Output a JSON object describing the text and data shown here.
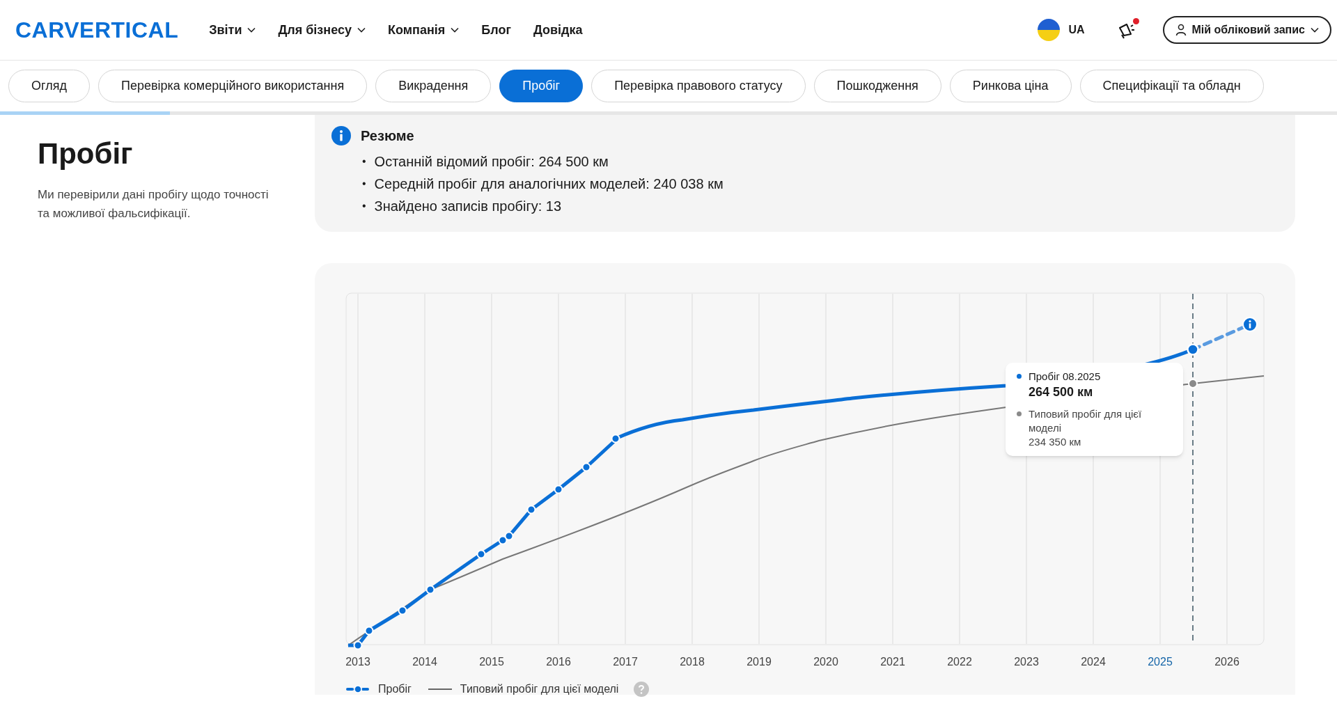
{
  "header": {
    "logo": "CARVERTICAL",
    "nav": [
      {
        "label": "Звіти",
        "has_menu": true
      },
      {
        "label": "Для бізнесу",
        "has_menu": true
      },
      {
        "label": "Компанія",
        "has_menu": true
      },
      {
        "label": "Блог",
        "has_menu": false
      },
      {
        "label": "Довідка",
        "has_menu": false
      }
    ],
    "language": "UA",
    "notification": true,
    "account": "Мій обліковий запис"
  },
  "tabs": [
    {
      "label": "Огляд",
      "selected": false
    },
    {
      "label": "Перевірка комерційного використання",
      "selected": false
    },
    {
      "label": "Викрадення",
      "selected": false
    },
    {
      "label": "Пробіг",
      "selected": true
    },
    {
      "label": "Перевірка правового статусу",
      "selected": false
    },
    {
      "label": "Пошкодження",
      "selected": false
    },
    {
      "label": "Ринкова ціна",
      "selected": false
    },
    {
      "label": "Специфікації та обладн",
      "selected": false
    }
  ],
  "scroll_progress": {
    "level": 0.127
  },
  "section": {
    "title": "Пробіг",
    "description": "Ми перевірили дані пробігу щодо точності та можливої фальсифікації."
  },
  "summary": {
    "title": "Резюме",
    "items": [
      {
        "marker": "•",
        "text": "Останній відомий пробіг: 264 500 км"
      },
      {
        "marker": "•",
        "text": "Середній пробіг для аналогічних моделей: 240 038 км"
      },
      {
        "marker": "•",
        "text": "Знайдено записів пробігу: 13"
      }
    ]
  },
  "chart": {
    "years": [
      {
        "label": "2013",
        "highlighted": false
      },
      {
        "label": "2014",
        "highlighted": false
      },
      {
        "label": "2015",
        "highlighted": false
      },
      {
        "label": "2016",
        "highlighted": false
      },
      {
        "label": "2017",
        "highlighted": false
      },
      {
        "label": "2018",
        "highlighted": false
      },
      {
        "label": "2019",
        "highlighted": false
      },
      {
        "label": "2020",
        "highlighted": false
      },
      {
        "label": "2021",
        "highlighted": false
      },
      {
        "label": "2022",
        "highlighted": false
      },
      {
        "label": "2023",
        "highlighted": false
      },
      {
        "label": "2024",
        "highlighted": false
      },
      {
        "label": "2025",
        "highlighted": true
      },
      {
        "label": "2026",
        "highlighted": false
      }
    ],
    "tooltip": {
      "title": "Пробіг 08.2025",
      "value": "264 500 км",
      "typical_label": "Типовий пробіг для цієї моделі",
      "typical_value": "234 350 км"
    },
    "legend": [
      {
        "label": "Пробіг",
        "kind": "mileage"
      },
      {
        "label": "Типовий пробіг для цієї моделі",
        "kind": "typical"
      }
    ]
  }
}
